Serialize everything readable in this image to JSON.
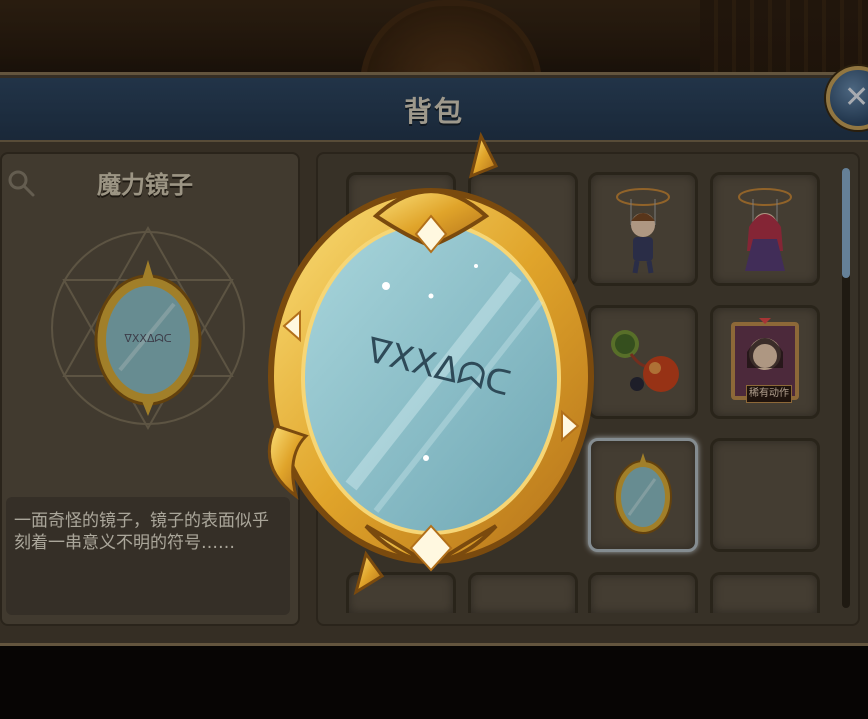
{
  "window": {
    "title": "背包",
    "close_label": "✕"
  },
  "detail": {
    "item_name": "魔力镜子",
    "description": "一面奇怪的镜子，镜子的表面似乎刻着一串意义不明的符号……"
  },
  "inventory": {
    "tag_label": "稀有动作",
    "slots": [
      "puppet-boy",
      "puppet-girl",
      "orbs",
      "portrait-card",
      "magic-mirror",
      "empty",
      "empty",
      "empty",
      "empty",
      "empty"
    ]
  },
  "colors": {
    "title_bar": "#24384f",
    "panel": "#4d4436",
    "gold": "#e0b13a",
    "mirror_glass": "#8fc3c9"
  }
}
